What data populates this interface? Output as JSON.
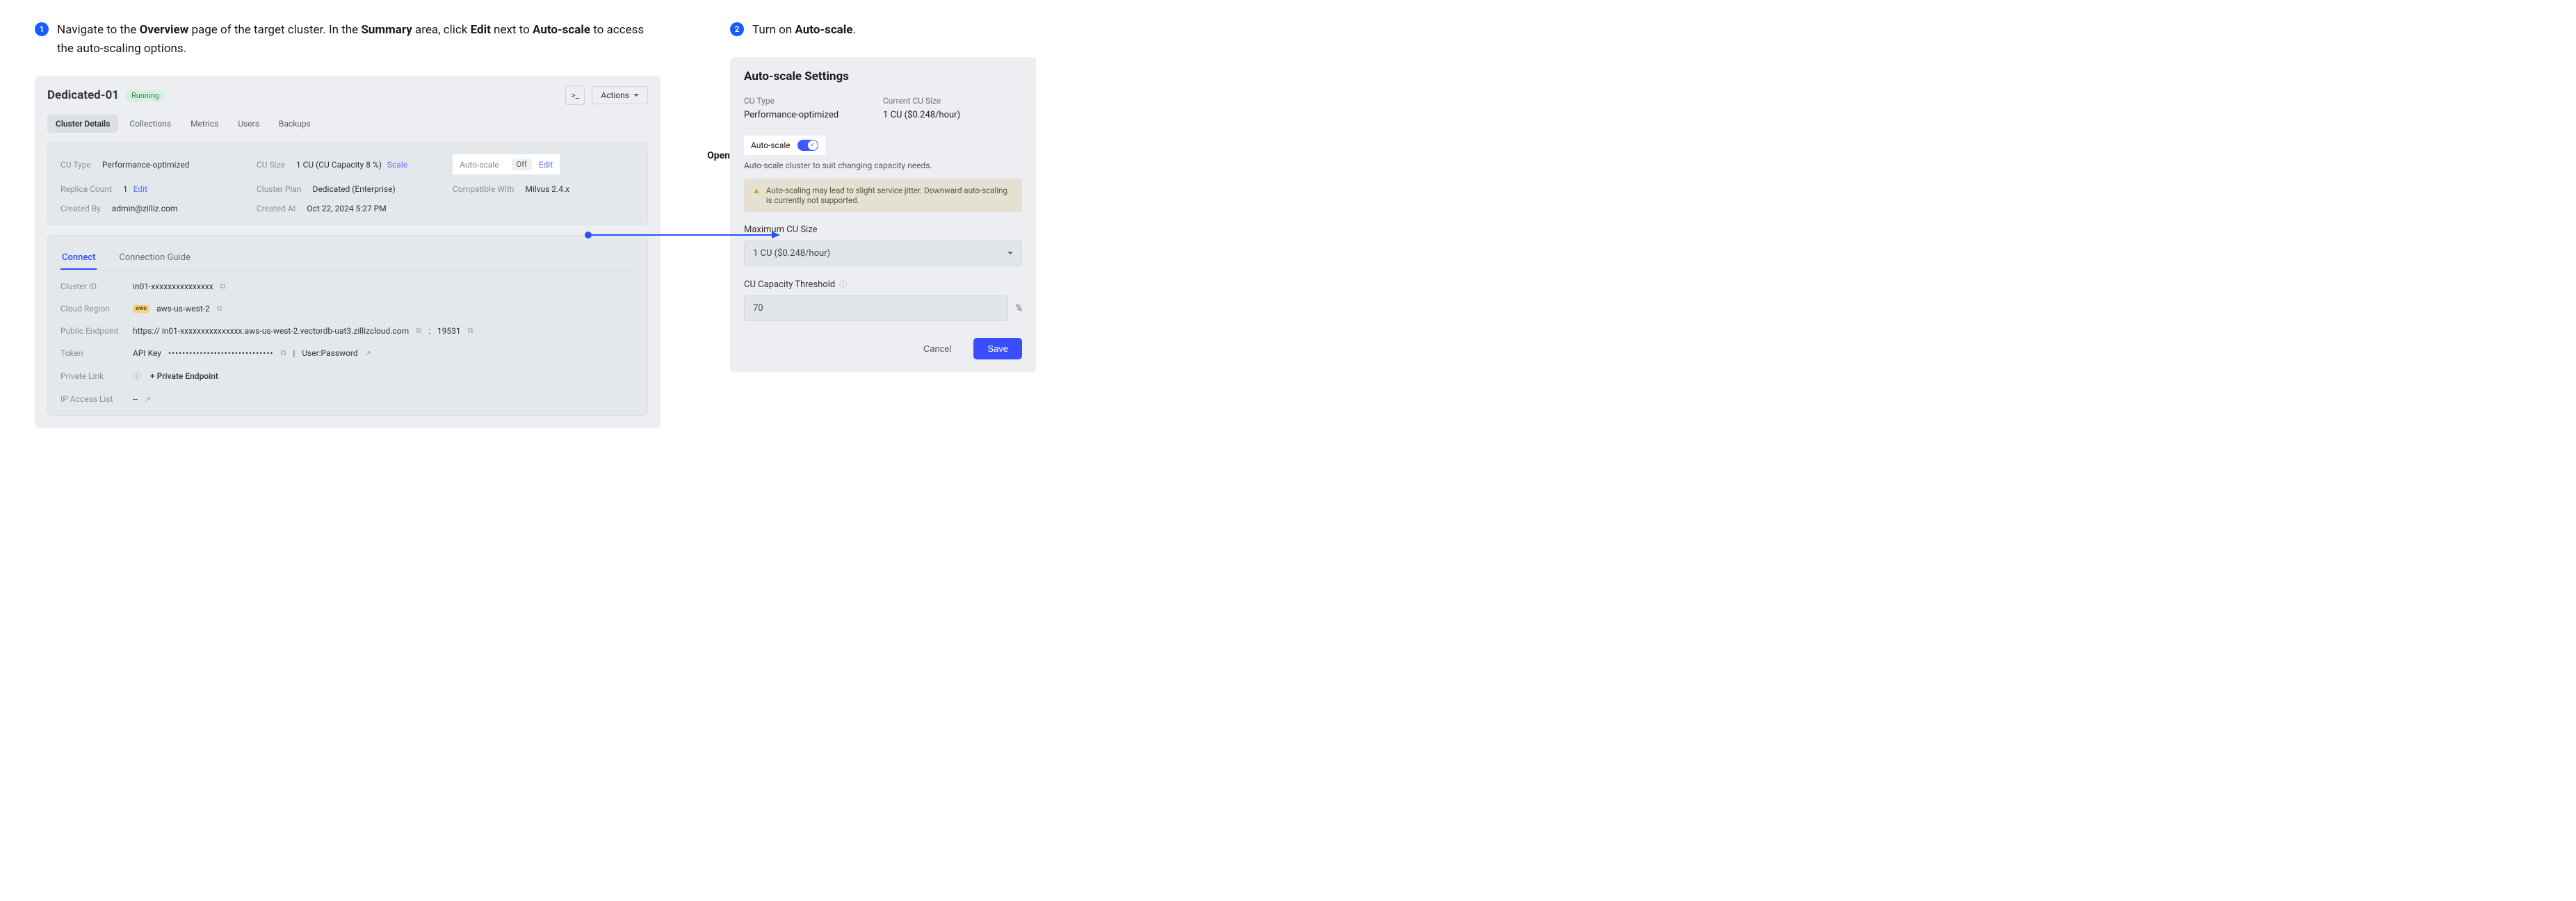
{
  "steps": {
    "s1_num": "1",
    "s1_pre": "Navigate to the ",
    "s1_b1": "Overview",
    "s1_mid1": " page of the target cluster. In the ",
    "s1_b2": "Summary",
    "s1_mid2": " area, click ",
    "s1_b3": "Edit",
    "s1_mid3": " next to ",
    "s1_b4": "Auto-scale",
    "s1_end": " to access the auto-scaling options.",
    "s2_num": "2",
    "s2_pre": "Turn on ",
    "s2_b1": "Auto-scale",
    "s2_end": "."
  },
  "cluster": {
    "name": "Dedicated-01",
    "status": "Running",
    "terminal_icon": ">_",
    "actions_label": "Actions"
  },
  "tabs": [
    "Cluster Details",
    "Collections",
    "Metrics",
    "Users",
    "Backups"
  ],
  "summary": {
    "cu_type_label": "CU Type",
    "cu_type_val": "Performance-optimized",
    "cu_size_label": "CU Size",
    "cu_size_val": "1 CU (CU Capacity 8 %)",
    "scale_link": "Scale",
    "auto_scale_label": "Auto-scale",
    "auto_scale_val": "Off",
    "auto_scale_edit": "Edit",
    "replica_label": "Replica Count",
    "replica_val": "1",
    "replica_edit": "Edit",
    "plan_label": "Cluster Plan",
    "plan_val": "Dedicated (Enterprise)",
    "compat_label": "Compatible With",
    "compat_val": "Milvus 2.4.x",
    "created_by_label": "Created By",
    "created_by_val": "admin@zilliz.com",
    "created_at_label": "Created At",
    "created_at_val": "Oct 22, 2024 5:27 PM"
  },
  "subtabs": [
    "Connect",
    "Connection Guide"
  ],
  "connect": {
    "cluster_id_label": "Cluster ID",
    "cluster_id_val": "in01-xxxxxxxxxxxxxxx",
    "region_label": "Cloud Region",
    "region_badge": "aws",
    "region_val": "aws-us-west-2",
    "endpoint_label": "Public Endpoint",
    "endpoint_val": "https:// in01-xxxxxxxxxxxxxxx.aws-us-west-2.vectordb-uat3.zillizcloud.com",
    "endpoint_port_sep": ":",
    "endpoint_port": "19531",
    "token_label": "Token",
    "token_type": "API Key",
    "token_mask": "••••••••••••••••••••••••••••••",
    "token_sep": "|",
    "token_userpw": "User:Password",
    "private_label": "Private Link",
    "private_add": "+  Private Endpoint",
    "ip_label": "IP Access List",
    "ip_val": "--"
  },
  "open_label": "Open",
  "settings": {
    "title": "Auto-scale Settings",
    "cu_type_label": "CU Type",
    "cu_type_val": "Performance-optimized",
    "cur_size_label": "Current CU Size",
    "cur_size_val": "1 CU ($0.248/hour)",
    "toggle_label": "Auto-scale",
    "help": "Auto-scale cluster to suit changing capacity needs.",
    "warn": "Auto-scaling may lead to slight service jitter. Downward auto-scaling is currently not supported.",
    "max_label": "Maximum CU Size",
    "max_val": "1 CU ($0.248/hour)",
    "thresh_label": "CU Capacity Threshold",
    "thresh_val": "70",
    "pct": "%",
    "cancel": "Cancel",
    "save": "Save"
  }
}
